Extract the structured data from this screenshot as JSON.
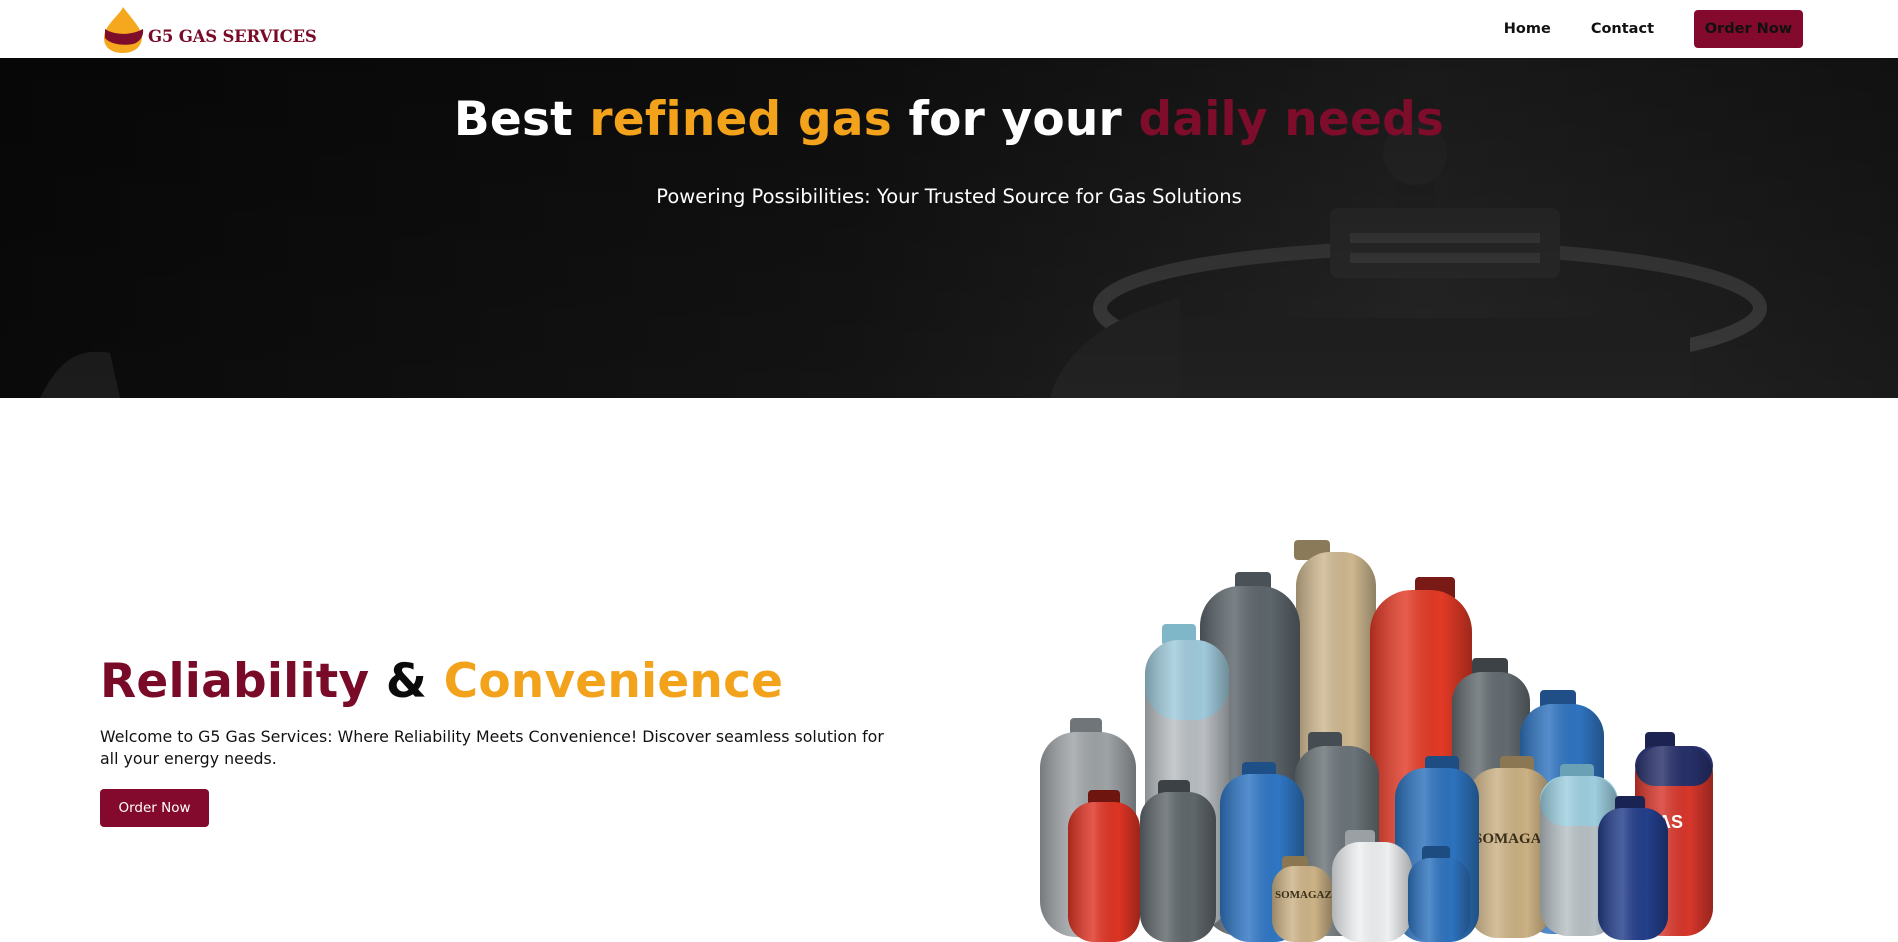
{
  "header": {
    "logo_text": "G5 GAS SERVICES",
    "nav": {
      "home": "Home",
      "contact": "Contact",
      "order_now": "Order Now"
    }
  },
  "hero": {
    "title": {
      "part1": "Best ",
      "part2": "refined gas",
      "part3": " for your ",
      "part4": "daily needs"
    },
    "subtitle": "Powering Possibilities: Your Trusted Source for Gas Solutions"
  },
  "main": {
    "heading": {
      "part1": "Reliability",
      "part2": " & ",
      "part3": "Convenience"
    },
    "text": "Welcome to G5 Gas Services: Where Reliability Meets Convenience! Discover seamless solution for all your energy needs.",
    "button": "Order Now"
  },
  "cylinder_labels": {
    "somagaz": "SOMAGAZ",
    "somagaz_small": "SOMAGAZ",
    "as_fragment": "AS"
  },
  "colors": {
    "brand_maroon": "#830a2c",
    "brand_orange": "#f2a21b",
    "hero_dark": "#0f0f0f"
  }
}
